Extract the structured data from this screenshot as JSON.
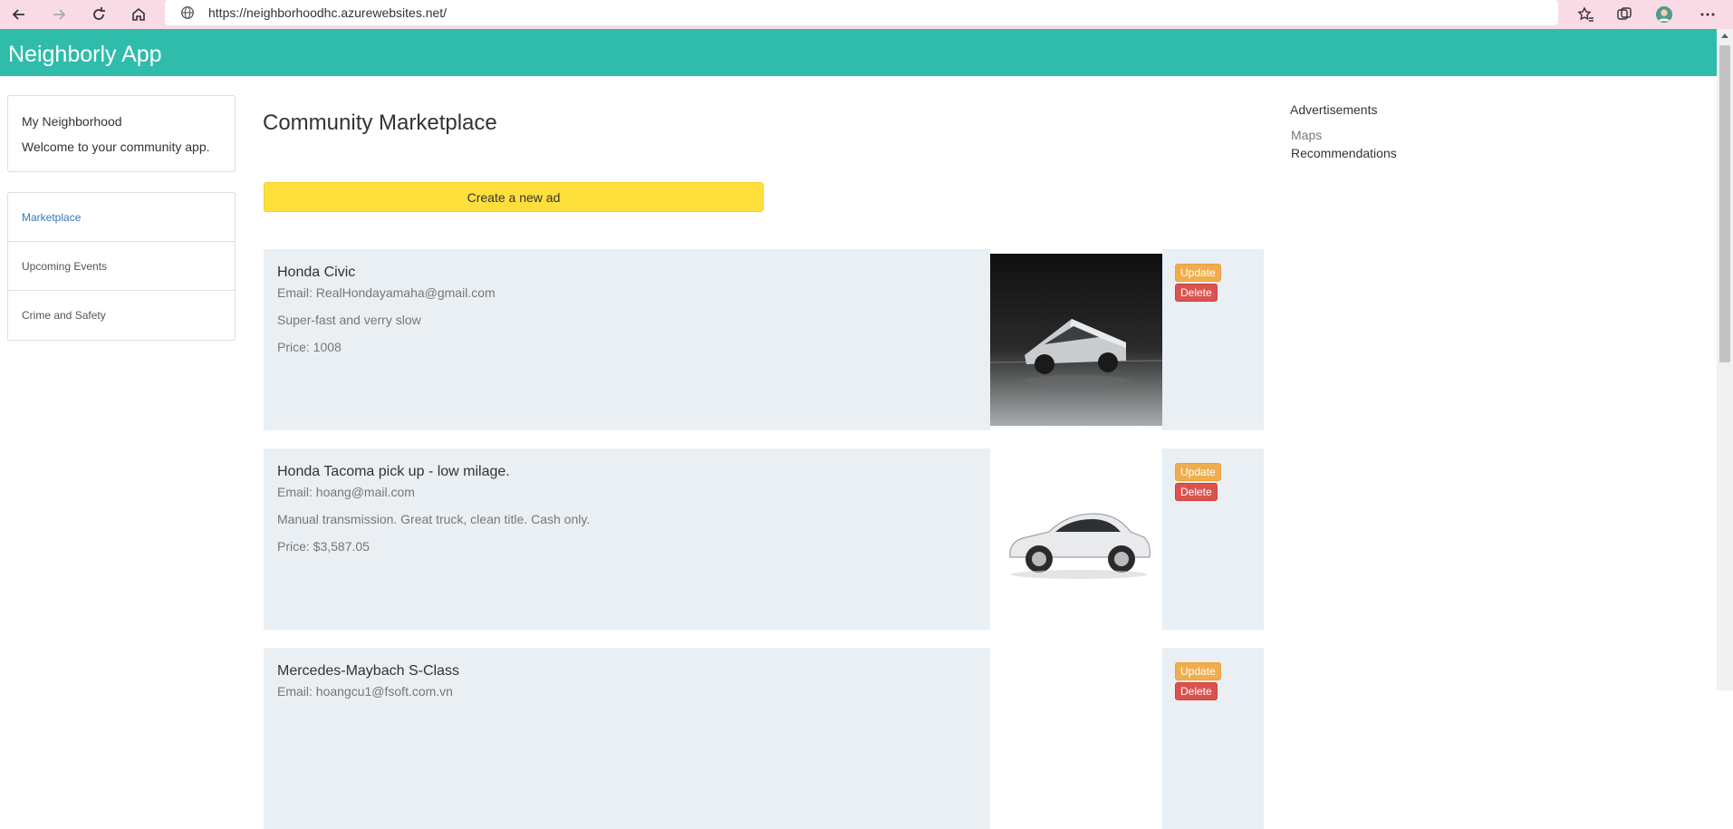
{
  "browser": {
    "url": "https://neighborhoodhc.azurewebsites.net/",
    "icons": [
      "back-arrow-icon",
      "forward-arrow-icon",
      "refresh-icon",
      "home-icon",
      "globe-icon",
      "favorites-icon",
      "collections-icon",
      "profile-avatar",
      "more-icon"
    ]
  },
  "app": {
    "title": "Neighborly App"
  },
  "sidebar": {
    "intro_title": "My Neighborhood",
    "intro_sub": "Welcome to your community app.",
    "items": [
      {
        "label": "Marketplace",
        "active": true
      },
      {
        "label": "Upcoming Events",
        "active": false
      },
      {
        "label": "Crime and Safety",
        "active": false
      }
    ]
  },
  "main": {
    "heading": "Community Marketplace",
    "create_button": "Create a new ad",
    "ads": [
      {
        "title": "Honda Civic",
        "email": "Email: RealHondayamaha@gmail.com",
        "description": "Super-fast and verry slow",
        "price": "Price: 1008",
        "image": "cybertruck-photo",
        "update_label": "Update",
        "delete_label": "Delete"
      },
      {
        "title": "Honda Tacoma pick up - low milage.",
        "email": "Email: hoang@mail.com",
        "description": "Manual transmission. Great truck, clean title. Cash only.",
        "price": "Price: $3,587.05",
        "image": "white-sedan-photo",
        "update_label": "Update",
        "delete_label": "Delete"
      },
      {
        "title": "Mercedes-Maybach S-Class",
        "email": "Email: hoangcu1@fsoft.com.vn",
        "description": "",
        "price": "",
        "image": "",
        "update_label": "Update",
        "delete_label": "Delete"
      }
    ]
  },
  "right": {
    "heading": "Advertisements",
    "maps": "Maps",
    "recommendations": "Recommendations"
  },
  "colors": {
    "header": "#2fbcab",
    "browser_bar": "#f9dbe6",
    "create_button": "#ffdf3c",
    "card_bg": "#e9eff3",
    "update": "#f0ad4e",
    "delete": "#d9534f"
  }
}
